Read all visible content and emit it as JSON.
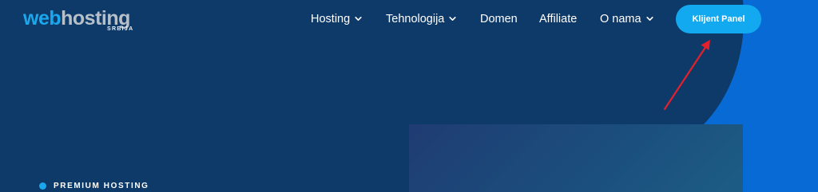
{
  "logo": {
    "text_web": "web",
    "text_hosting": "hosting",
    "text_sub": "SRBIJA"
  },
  "nav": {
    "items": [
      {
        "label": "Hosting",
        "has_dropdown": true
      },
      {
        "label": "Tehnologija",
        "has_dropdown": true
      },
      {
        "label": "Domen",
        "has_dropdown": false
      },
      {
        "label": "Affiliate",
        "has_dropdown": false
      },
      {
        "label": "O nama",
        "has_dropdown": true
      }
    ],
    "cta_label": "Klijent Panel"
  },
  "hero": {
    "tagline": "PREMIUM HOSTING"
  },
  "colors": {
    "background": "#0e3a69",
    "accent_blue": "#1aa7ec",
    "bright_blue": "#086bd5",
    "annotation_arrow": "#e5202a"
  }
}
